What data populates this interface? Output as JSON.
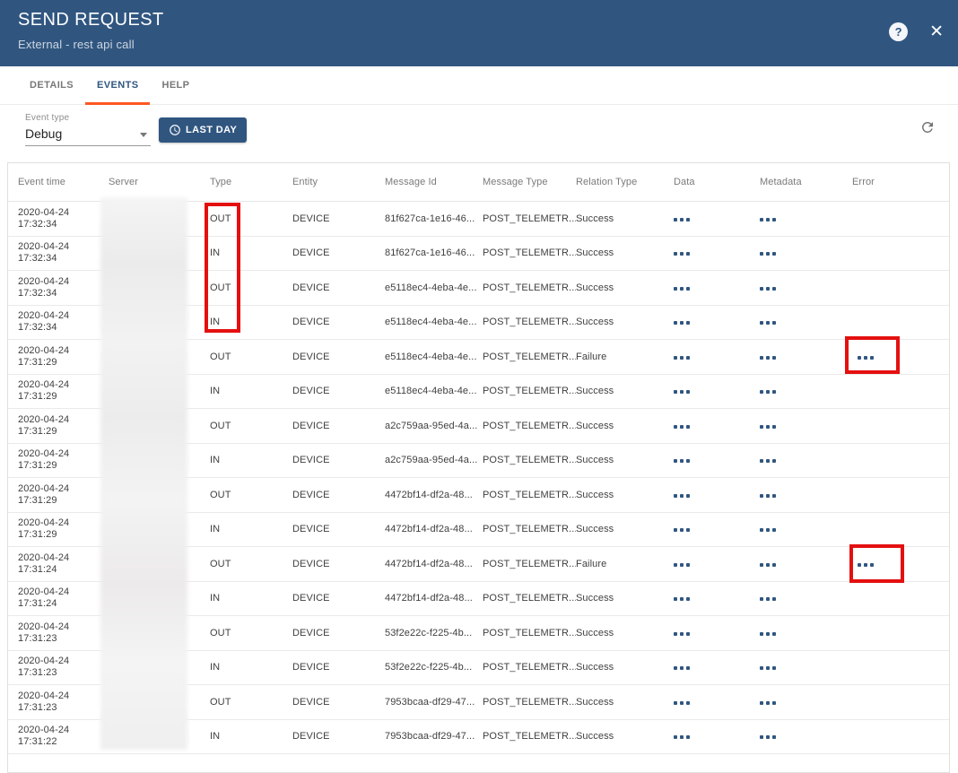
{
  "dialog": {
    "title": "SEND REQUEST",
    "subtitle": "External - rest api call",
    "help_glyph": "?",
    "close_glyph": "✕"
  },
  "tabs": [
    {
      "label": "DETAILS",
      "active": false
    },
    {
      "label": "EVENTS",
      "active": true
    },
    {
      "label": "HELP",
      "active": false
    }
  ],
  "filter": {
    "event_type_label": "Event type",
    "event_type_value": "Debug",
    "range_button_label": "LAST DAY"
  },
  "icons": {
    "clock": "clock-icon",
    "refresh": "refresh-icon",
    "more": "three-dots-icon"
  },
  "colors": {
    "primary": "#305680",
    "accent": "#ff5722",
    "annotation": "#e41010"
  },
  "table": {
    "columns": [
      "Event time",
      "Server",
      "Type",
      "Entity",
      "Message Id",
      "Message Type",
      "Relation Type",
      "Data",
      "Metadata",
      "Error"
    ],
    "rows": [
      {
        "date": "2020-04-24",
        "time": "17:32:34",
        "type": "OUT",
        "entity": "DEVICE",
        "message_id": "81f627ca-1e16-46...",
        "message_type": "POST_TELEMETR...",
        "relation_type": "Success",
        "data": true,
        "metadata": true,
        "error": false
      },
      {
        "date": "2020-04-24",
        "time": "17:32:34",
        "type": "IN",
        "entity": "DEVICE",
        "message_id": "81f627ca-1e16-46...",
        "message_type": "POST_TELEMETR...",
        "relation_type": "Success",
        "data": true,
        "metadata": true,
        "error": false
      },
      {
        "date": "2020-04-24",
        "time": "17:32:34",
        "type": "OUT",
        "entity": "DEVICE",
        "message_id": "e5118ec4-4eba-4e...",
        "message_type": "POST_TELEMETR...",
        "relation_type": "Success",
        "data": true,
        "metadata": true,
        "error": false
      },
      {
        "date": "2020-04-24",
        "time": "17:32:34",
        "type": "IN",
        "entity": "DEVICE",
        "message_id": "e5118ec4-4eba-4e...",
        "message_type": "POST_TELEMETR...",
        "relation_type": "Success",
        "data": true,
        "metadata": true,
        "error": false
      },
      {
        "date": "2020-04-24",
        "time": "17:31:29",
        "type": "OUT",
        "entity": "DEVICE",
        "message_id": "e5118ec4-4eba-4e...",
        "message_type": "POST_TELEMETR...",
        "relation_type": "Failure",
        "data": true,
        "metadata": true,
        "error": true
      },
      {
        "date": "2020-04-24",
        "time": "17:31:29",
        "type": "IN",
        "entity": "DEVICE",
        "message_id": "e5118ec4-4eba-4e...",
        "message_type": "POST_TELEMETR...",
        "relation_type": "Success",
        "data": true,
        "metadata": true,
        "error": false
      },
      {
        "date": "2020-04-24",
        "time": "17:31:29",
        "type": "OUT",
        "entity": "DEVICE",
        "message_id": "a2c759aa-95ed-4a...",
        "message_type": "POST_TELEMETR...",
        "relation_type": "Success",
        "data": true,
        "metadata": true,
        "error": false
      },
      {
        "date": "2020-04-24",
        "time": "17:31:29",
        "type": "IN",
        "entity": "DEVICE",
        "message_id": "a2c759aa-95ed-4a...",
        "message_type": "POST_TELEMETR...",
        "relation_type": "Success",
        "data": true,
        "metadata": true,
        "error": false
      },
      {
        "date": "2020-04-24",
        "time": "17:31:29",
        "type": "OUT",
        "entity": "DEVICE",
        "message_id": "4472bf14-df2a-48...",
        "message_type": "POST_TELEMETR...",
        "relation_type": "Success",
        "data": true,
        "metadata": true,
        "error": false
      },
      {
        "date": "2020-04-24",
        "time": "17:31:29",
        "type": "IN",
        "entity": "DEVICE",
        "message_id": "4472bf14-df2a-48...",
        "message_type": "POST_TELEMETR...",
        "relation_type": "Success",
        "data": true,
        "metadata": true,
        "error": false
      },
      {
        "date": "2020-04-24",
        "time": "17:31:24",
        "type": "OUT",
        "entity": "DEVICE",
        "message_id": "4472bf14-df2a-48...",
        "message_type": "POST_TELEMETR...",
        "relation_type": "Failure",
        "data": true,
        "metadata": true,
        "error": true
      },
      {
        "date": "2020-04-24",
        "time": "17:31:24",
        "type": "IN",
        "entity": "DEVICE",
        "message_id": "4472bf14-df2a-48...",
        "message_type": "POST_TELEMETR...",
        "relation_type": "Success",
        "data": true,
        "metadata": true,
        "error": false
      },
      {
        "date": "2020-04-24",
        "time": "17:31:23",
        "type": "OUT",
        "entity": "DEVICE",
        "message_id": "53f2e22c-f225-4b...",
        "message_type": "POST_TELEMETR...",
        "relation_type": "Success",
        "data": true,
        "metadata": true,
        "error": false
      },
      {
        "date": "2020-04-24",
        "time": "17:31:23",
        "type": "IN",
        "entity": "DEVICE",
        "message_id": "53f2e22c-f225-4b...",
        "message_type": "POST_TELEMETR...",
        "relation_type": "Success",
        "data": true,
        "metadata": true,
        "error": false
      },
      {
        "date": "2020-04-24",
        "time": "17:31:23",
        "type": "OUT",
        "entity": "DEVICE",
        "message_id": "7953bcaa-df29-47...",
        "message_type": "POST_TELEMETR...",
        "relation_type": "Success",
        "data": true,
        "metadata": true,
        "error": false
      },
      {
        "date": "2020-04-24",
        "time": "17:31:22",
        "type": "IN",
        "entity": "DEVICE",
        "message_id": "7953bcaa-df29-47...",
        "message_type": "POST_TELEMETR...",
        "relation_type": "Success",
        "data": true,
        "metadata": true,
        "error": false
      }
    ]
  },
  "annotations": [
    {
      "highlights": "type-column-rows-1-4"
    },
    {
      "highlights": "error-dots-row-5"
    },
    {
      "highlights": "error-dots-row-11"
    }
  ]
}
